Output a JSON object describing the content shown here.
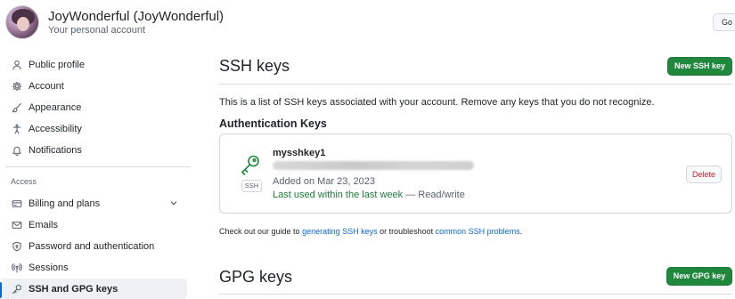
{
  "header": {
    "display_name": "JoyWonderful",
    "handle": "(JoyWonderful)",
    "subtitle": "Your personal account",
    "go_button": "Go"
  },
  "sidebar": {
    "items": [
      {
        "label": "Public profile",
        "icon": "person-icon"
      },
      {
        "label": "Account",
        "icon": "gear-icon"
      },
      {
        "label": "Appearance",
        "icon": "paintbrush-icon"
      },
      {
        "label": "Accessibility",
        "icon": "accessibility-icon"
      },
      {
        "label": "Notifications",
        "icon": "bell-icon"
      }
    ],
    "access_label": "Access",
    "access_items": [
      {
        "label": "Billing and plans",
        "icon": "credit-card-icon",
        "expandable": true
      },
      {
        "label": "Emails",
        "icon": "mail-icon"
      },
      {
        "label": "Password and authentication",
        "icon": "shield-lock-icon"
      },
      {
        "label": "Sessions",
        "icon": "broadcast-icon"
      },
      {
        "label": "SSH and GPG keys",
        "icon": "key-icon",
        "active": true
      }
    ]
  },
  "main": {
    "ssh_title": "SSH keys",
    "new_ssh_button": "New SSH key",
    "intro": "This is a list of SSH keys associated with your account. Remove any keys that you do not recognize.",
    "auth_heading": "Authentication Keys",
    "key": {
      "name": "mysshkey1",
      "type_tag": "SSH",
      "added": "Added on Mar 23, 2023",
      "last_used": "Last used within the last week",
      "access": " — Read/write",
      "delete_button": "Delete"
    },
    "guide": {
      "prefix": "Check out our guide to ",
      "link1": "generating SSH keys",
      "middle": " or troubleshoot ",
      "link2": "common SSH problems",
      "suffix": "."
    },
    "gpg_title": "GPG keys",
    "new_gpg_button": "New GPG key"
  },
  "colors": {
    "accent_green": "#1f883d",
    "link_blue": "#0969da",
    "danger_red": "#cf222e",
    "active_indicator": "#0969da"
  }
}
